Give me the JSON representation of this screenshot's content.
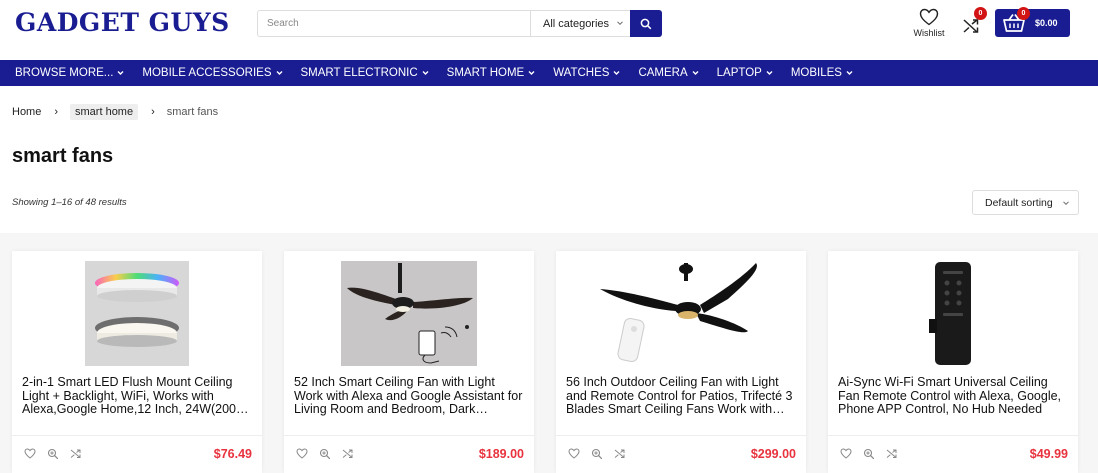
{
  "brand": {
    "name": "GADGET GUYS"
  },
  "search": {
    "placeholder": "Search",
    "category": "All categories"
  },
  "header": {
    "wishlist_label": "Wishlist",
    "compare_count": "0",
    "cart_count": "0",
    "cart_total": "$0.00"
  },
  "nav": [
    {
      "label": "BROWSE MORE..."
    },
    {
      "label": "MOBILE ACCESSORIES"
    },
    {
      "label": "SMART ELECTRONIC"
    },
    {
      "label": "SMART HOME"
    },
    {
      "label": "WATCHES"
    },
    {
      "label": "CAMERA"
    },
    {
      "label": "LAPTOP"
    },
    {
      "label": "MOBILES"
    }
  ],
  "breadcrumb": {
    "home": "Home",
    "parent": "smart home",
    "current": "smart fans"
  },
  "page": {
    "title": "smart fans",
    "results": "Showing 1–16 of 48 results",
    "sorting": "Default sorting"
  },
  "products": [
    {
      "title": "2-in-1 Smart LED Flush Mount Ceiling Light + Backlight, WiFi, Works with Alexa,Google Home,12 Inch, 24W(200…",
      "price": "$76.49",
      "image": "ceiling-light-image"
    },
    {
      "title": "52 Inch Smart Ceiling Fan with Light Work with Alexa and Google Assistant for Living Room and Bedroom, Dark…",
      "price": "$189.00",
      "image": "ceiling-fan-image"
    },
    {
      "title": "56 Inch Outdoor Ceiling Fan with Light and Remote Control for Patios, Trifecté 3 Blades Smart Ceiling Fans Work with…",
      "price": "$299.00",
      "image": "outdoor-fan-image"
    },
    {
      "title": "Ai-Sync Wi-Fi Smart Universal Ceiling Fan Remote Control with Alexa, Google, Phone APP Control, No Hub Needed",
      "price": "$49.99",
      "image": "fan-remote-image"
    }
  ],
  "colors": {
    "brand": "#1a1d92",
    "price": "#e8323e",
    "badge": "#d21414"
  }
}
